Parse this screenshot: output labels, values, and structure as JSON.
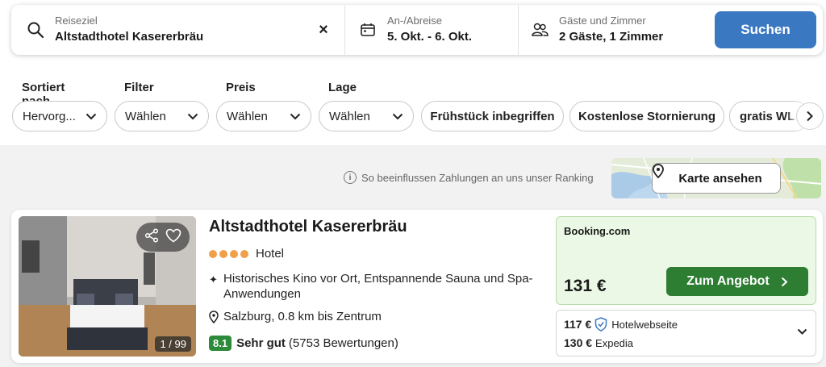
{
  "search": {
    "destination_label": "Reiseziel",
    "destination_value": "Altstadthotel Kasererbräu",
    "clear_symbol": "×",
    "dates_label": "An-/Abreise",
    "dates_value": "5. Okt. - 6. Okt.",
    "guests_label": "Gäste und Zimmer",
    "guests_value": "2 Gäste, 1 Zimmer",
    "search_button": "Suchen"
  },
  "filters": {
    "sort": {
      "title": "Sortiert nach",
      "value": "Hervorg..."
    },
    "filter": {
      "title": "Filter",
      "value": "Wählen"
    },
    "price": {
      "title": "Preis",
      "value": "Wählen"
    },
    "location": {
      "title": "Lage",
      "value": "Wählen"
    },
    "tags": [
      "Frühstück inbegriffen",
      "Kostenlose Stornierung",
      "gratis WL"
    ]
  },
  "ranking_note": "So beeinflussen Zahlungen an uns unser Ranking",
  "map": {
    "button_label": "Karte ansehen"
  },
  "result": {
    "name": "Altstadthotel Kasererbräu",
    "star_count": 4,
    "type": "Hotel",
    "features": "Historisches Kino vor Ort, Entspannende Sauna und Spa-Anwendungen",
    "location": "Salzburg, 0.8 km bis Zentrum",
    "score": "8.1",
    "rating_word": "Sehr gut",
    "reviews": "(5753 Bewertungen)",
    "photo_counter": "1 / 99",
    "offer": {
      "provider": "Booking.com",
      "price": "131 €",
      "button": "Zum Angebot"
    },
    "alternatives": [
      {
        "price": "117 €",
        "provider": "Hotelwebseite"
      },
      {
        "price": "130 €",
        "provider": "Expedia"
      }
    ]
  },
  "colors": {
    "primary_blue": "#3a78c2",
    "deal_green": "#2d7d32",
    "score_green": "#2d8a39",
    "star_orange": "#f0a04a",
    "offer_bg": "#ecf8e6"
  }
}
